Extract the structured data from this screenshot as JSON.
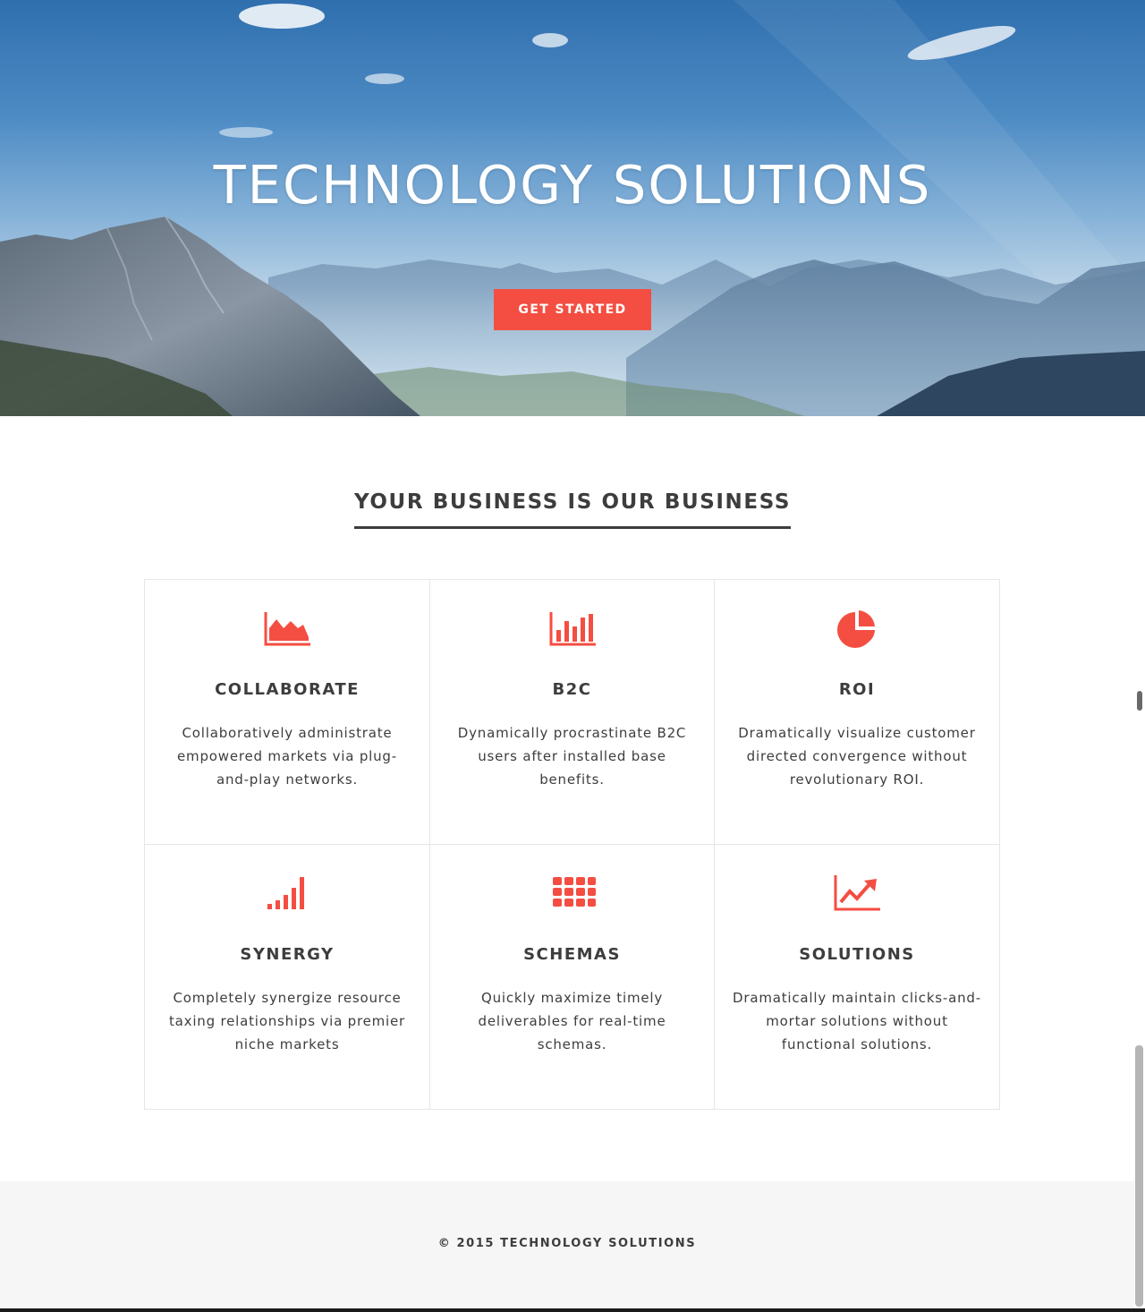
{
  "hero": {
    "title": "TECHNOLOGY SOLUTIONS",
    "cta_label": "GET STARTED",
    "accent": "#f44e42"
  },
  "section": {
    "title": "YOUR BUSINESS IS OUR BUSINESS"
  },
  "features": [
    {
      "icon": "area-chart-icon",
      "title": "COLLABORATE",
      "text": "Collaboratively administrate empowered markets via plug-and-play networks."
    },
    {
      "icon": "bar-chart-icon",
      "title": "B2C",
      "text": "Dynamically procrastinate B2C users after installed base benefits."
    },
    {
      "icon": "pie-chart-icon",
      "title": "ROI",
      "text": "Dramatically visualize customer directed convergence without revolutionary ROI."
    },
    {
      "icon": "signal-bars-icon",
      "title": "SYNERGY",
      "text": "Completely synergize resource taxing relationships via premier niche markets"
    },
    {
      "icon": "grid-icon",
      "title": "SCHEMAS",
      "text": "Quickly maximize timely deliverables for real-time schemas."
    },
    {
      "icon": "line-chart-icon",
      "title": "SOLUTIONS",
      "text": "Dramatically maintain clicks-and-mortar solutions without functional solutions."
    }
  ],
  "footer": {
    "copyright": "© 2015 TECHNOLOGY SOLUTIONS"
  }
}
